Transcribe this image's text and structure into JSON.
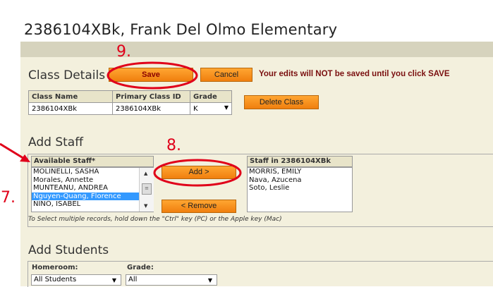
{
  "window": {
    "title": "2386104XBk, Frank Del Olmo Elementary"
  },
  "class_details": {
    "heading": "Class Details",
    "save_label": "Save",
    "cancel_label": "Cancel",
    "warning": "Your edits will NOT be saved until you click SAVE",
    "columns": [
      "Class Name",
      "Primary Class ID",
      "Grade"
    ],
    "row": {
      "class_name": "2386104XBk",
      "primary_class_id": "2386104XBk",
      "grade": "K"
    },
    "delete_label": "Delete Class"
  },
  "add_staff": {
    "heading": "Add Staff",
    "available_heading": "Available Staff*",
    "available": [
      "MOLINELLI, SASHA",
      "Morales, Annette",
      "MUNTEANU, ANDREA",
      "Nguyen-Quang, Florence",
      "NINO, ISABEL"
    ],
    "selected_index": 3,
    "add_label": "Add >",
    "remove_label": "< Remove",
    "staff_in_heading": "Staff in 2386104XBk",
    "staff_in": [
      "MORRIS, EMILY",
      "Nava, Azucena",
      "Soto, Leslie"
    ],
    "hint": "To Select multiple records, hold down the \"Ctrl\" key (PC) or the Apple key (Mac)"
  },
  "add_students": {
    "heading": "Add Students",
    "homeroom_label": "Homeroom:",
    "homeroom_value": "All Students",
    "grade_label": "Grade:",
    "grade_value": "All"
  },
  "annotations": {
    "step7": "7.",
    "step8": "8.",
    "step9": "9.",
    "color": "#e0001a"
  }
}
